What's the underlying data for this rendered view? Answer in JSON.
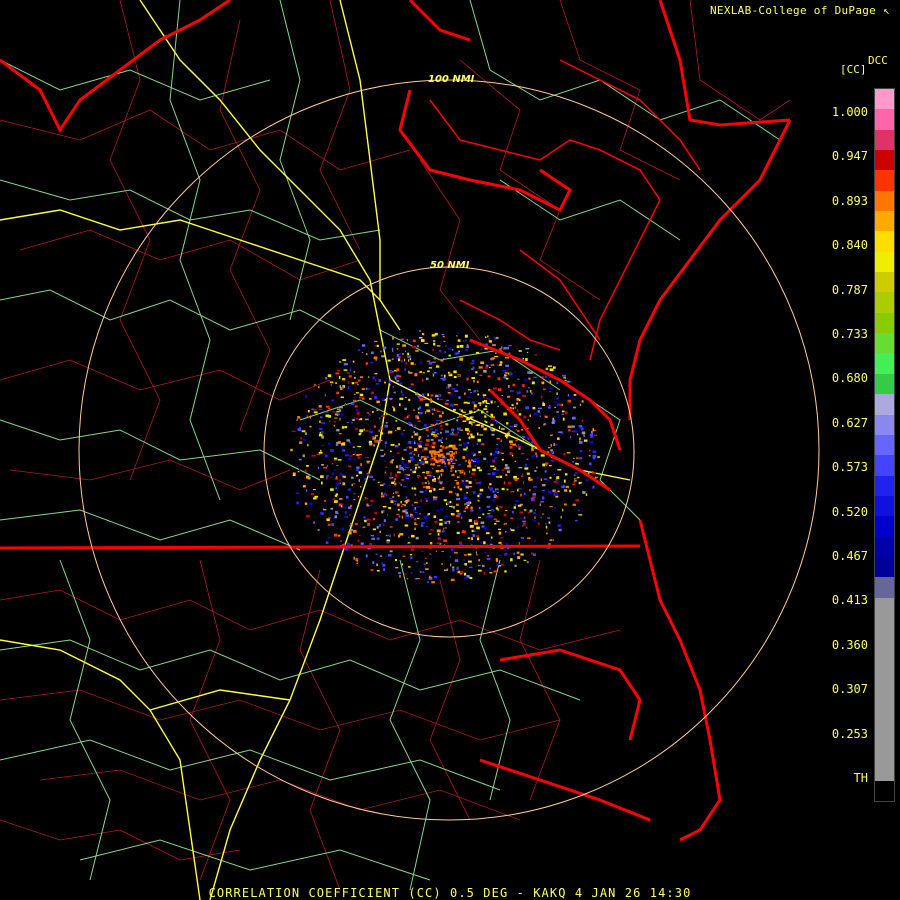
{
  "header": {
    "credit": "NEXLAB-College of DuPage"
  },
  "legend": {
    "product": "DCC",
    "units": "[CC]",
    "ticks": [
      "1.000",
      "0.947",
      "0.893",
      "0.840",
      "0.787",
      "0.733",
      "0.680",
      "0.627",
      "0.573",
      "0.520",
      "0.467",
      "0.413",
      "0.360",
      "0.307",
      "0.253",
      "TH"
    ],
    "colors": [
      "#ff99cc",
      "#ff66aa",
      "#dd3366",
      "#cc0000",
      "#ff3300",
      "#ff7700",
      "#ffaa00",
      "#ffdd00",
      "#eeee00",
      "#cccc00",
      "#aacc00",
      "#88cc00",
      "#66dd33",
      "#44ee55",
      "#33cc44",
      "#aaaadd",
      "#8888ee",
      "#6666ff",
      "#4444ff",
      "#2222ee",
      "#1111dd",
      "#0000cc",
      "#0000aa",
      "#000099",
      "#666699",
      "#999999",
      "#999999",
      "#999999",
      "#999999",
      "#999999",
      "#999999",
      "#999999",
      "#999999",
      "#999999",
      "#000000"
    ]
  },
  "range_rings": [
    {
      "label": "100 NMI"
    },
    {
      "label": "50 NMI"
    }
  ],
  "footer": {
    "caption": "CORRELATION COEFFICIENT (CC) 0.5 DEG - KAKQ 4 JAN 26 14:30"
  },
  "colors": {
    "state_borders": "#ff0000",
    "county_lines": "#cc2222",
    "highways": "#99ee99",
    "interstates": "#ffff44",
    "rings": "#ffcc99",
    "text": "#ffff66"
  }
}
